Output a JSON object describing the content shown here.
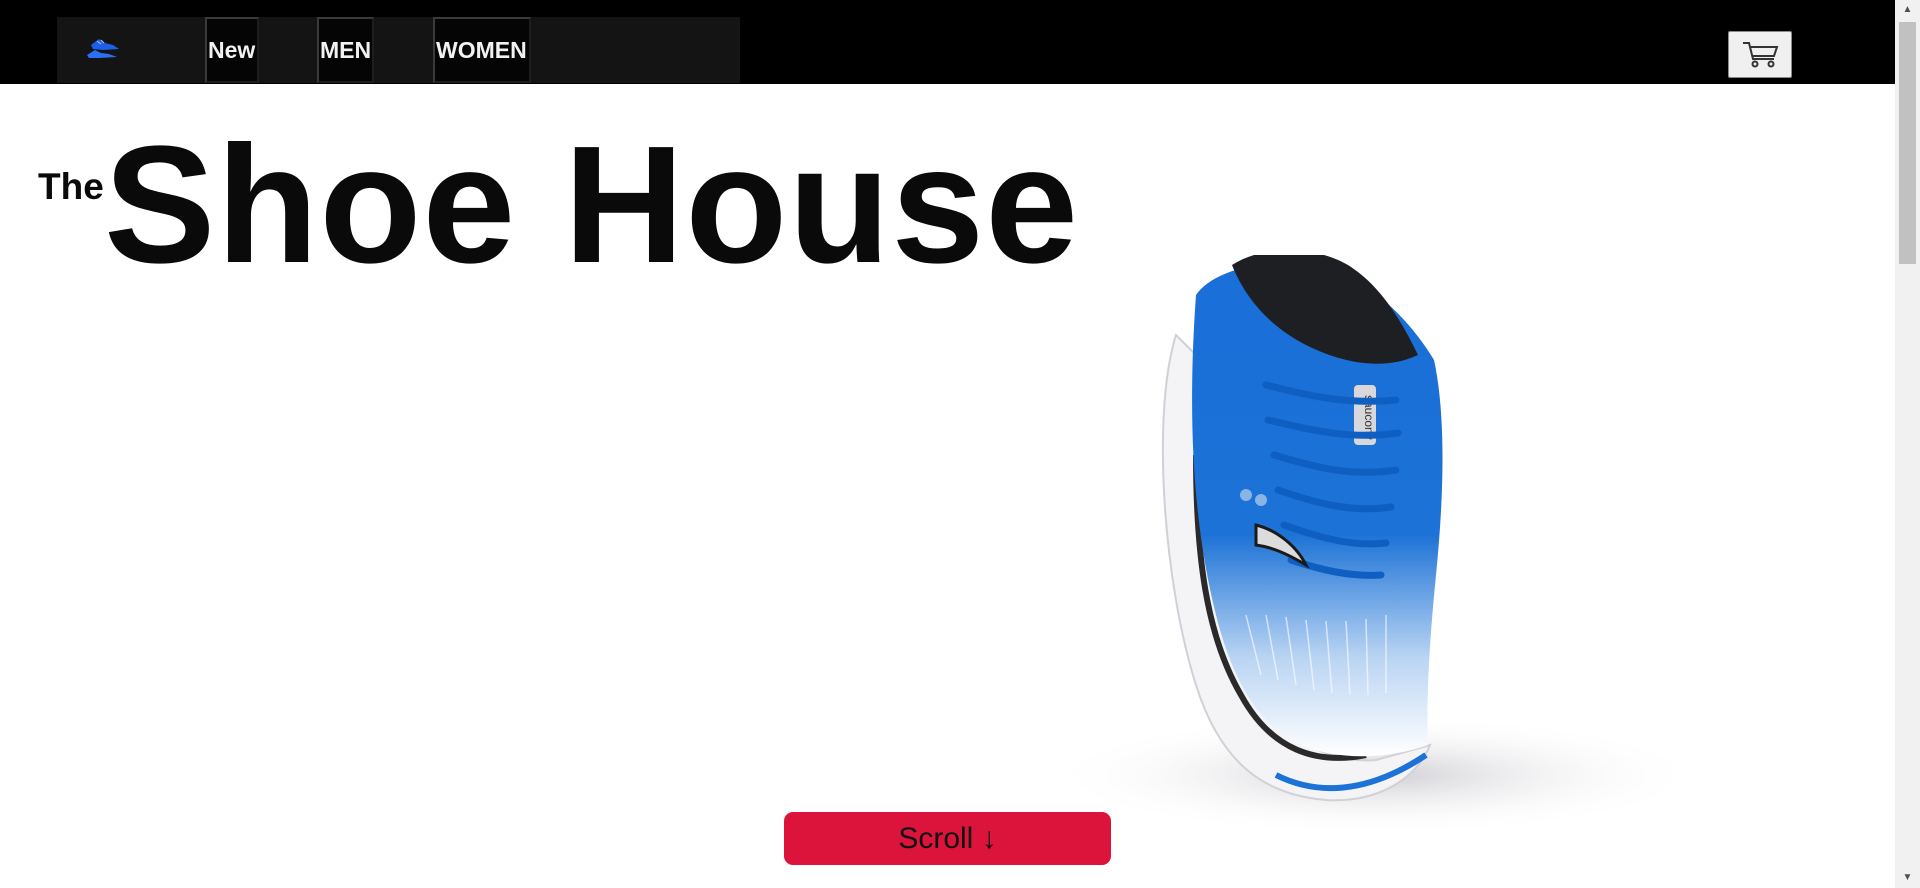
{
  "nav": {
    "logo_icon": "sneaker-logo-icon",
    "items": [
      {
        "label": "New"
      },
      {
        "label": "MEN"
      },
      {
        "label": "WOMEN"
      }
    ]
  },
  "cart": {
    "icon": "shopping-cart-icon"
  },
  "hero": {
    "title_prefix": "The",
    "title": "Shoe House",
    "image": "blue-white-running-shoe"
  },
  "scroll_button": {
    "label": "Scroll ↓"
  },
  "colors": {
    "topbar": "#000000",
    "nav_panel": "#141414",
    "accent": "#dc143c",
    "shoe_blue": "#1c72d6"
  }
}
